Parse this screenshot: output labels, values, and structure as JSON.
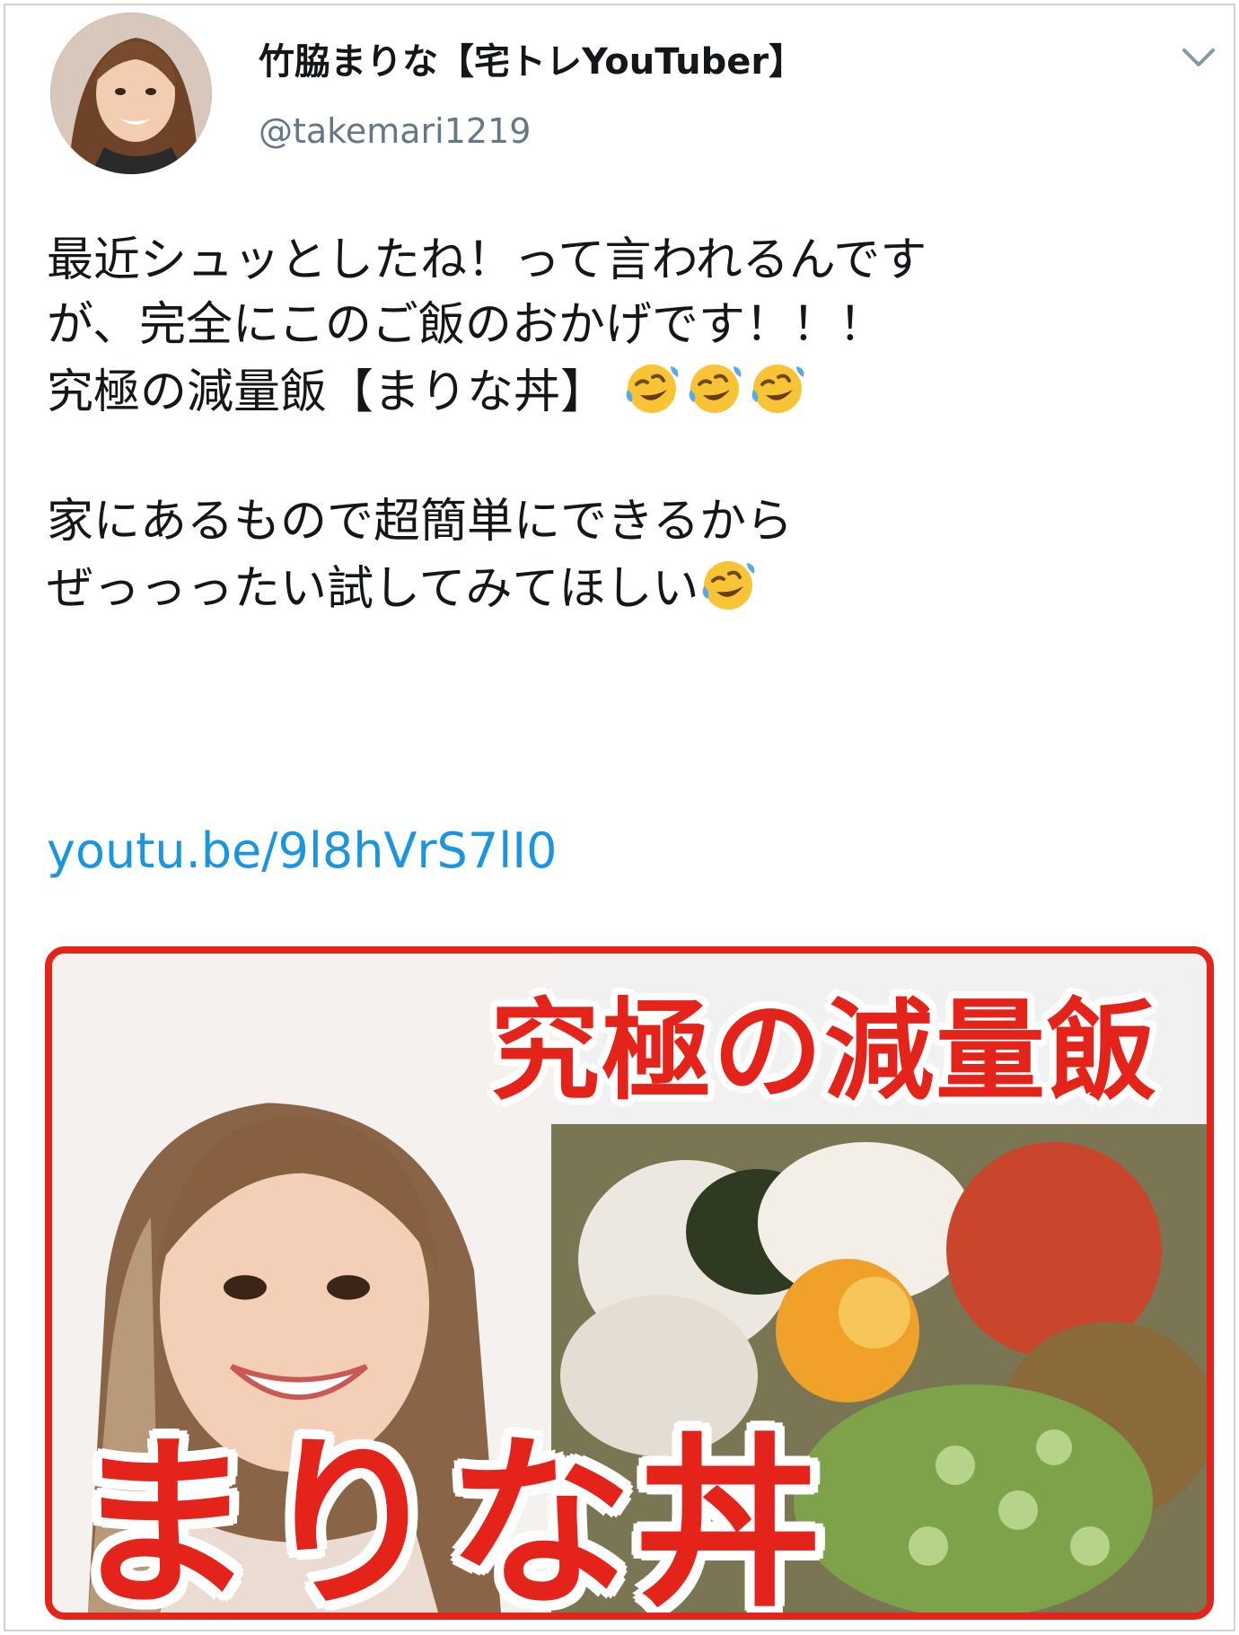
{
  "author": {
    "display_name": "竹脇まりな【宅トレYouTuber】",
    "handle": "@takemari1219",
    "avatar_icon": "profile-photo-avatar"
  },
  "menu": {
    "icon": "chevron-down-icon"
  },
  "tweet": {
    "line1": "最近シュッとしたね！って言われるんです",
    "line2": "が、完全にこのご飯のおかげです！！！",
    "line3_text": "究極の減量飯【まりな丼】",
    "line3_emojis": [
      "rolling-on-floor-laughing",
      "rolling-on-floor-laughing",
      "rolling-on-floor-laughing"
    ],
    "line4": "家にあるもので超簡単にできるから",
    "line5_text": "ぜっっったい試してみてほしい",
    "line5_emojis": [
      "rolling-on-floor-laughing"
    ]
  },
  "link": {
    "text": "youtu.be/9l8hVrS7lI0",
    "color": "#1b95e0"
  },
  "media": {
    "title_top": "究極の減量飯",
    "title_bottom": "まりな丼",
    "accent_color": "#e4231b"
  }
}
